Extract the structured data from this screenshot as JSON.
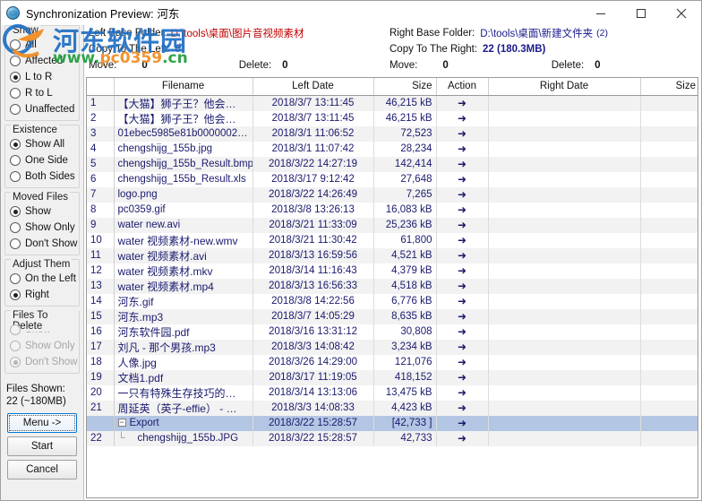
{
  "window": {
    "title": "Synchronization Preview: 河东",
    "icon": "globe-icon",
    "minimize": "−",
    "maximize": "□",
    "close": "✕"
  },
  "watermark": {
    "cn": "河东软件园",
    "en_prefix": "www.",
    "en_mid": "pc0359",
    "en_suffix": ".cn",
    "full_en": "www.pc0359.cn"
  },
  "sidebar": {
    "groups": [
      {
        "label": "Show",
        "items": [
          {
            "label": "All",
            "checked": false,
            "disabled": false
          },
          {
            "label": "Affected",
            "checked": false,
            "disabled": false
          },
          {
            "label": "L to R",
            "checked": true,
            "disabled": false
          },
          {
            "label": "R to L",
            "checked": false,
            "disabled": false
          },
          {
            "label": "Unaffected",
            "checked": false,
            "disabled": false
          }
        ]
      },
      {
        "label": "Existence",
        "items": [
          {
            "label": "Show All",
            "checked": true,
            "disabled": false
          },
          {
            "label": "One Side",
            "checked": false,
            "disabled": false
          },
          {
            "label": "Both Sides",
            "checked": false,
            "disabled": false
          }
        ]
      },
      {
        "label": "Moved Files",
        "items": [
          {
            "label": "Show",
            "checked": true,
            "disabled": false
          },
          {
            "label": "Show Only",
            "checked": false,
            "disabled": false
          },
          {
            "label": "Don't Show",
            "checked": false,
            "disabled": false
          }
        ]
      },
      {
        "label": "Adjust Them",
        "items": [
          {
            "label": "On the Left",
            "checked": false,
            "disabled": false
          },
          {
            "label": "Right",
            "checked": true,
            "disabled": false
          }
        ]
      },
      {
        "label": "Files To Delete",
        "items": [
          {
            "label": "Show",
            "checked": false,
            "disabled": true
          },
          {
            "label": "Show Only",
            "checked": false,
            "disabled": true
          },
          {
            "label": "Don't Show",
            "checked": true,
            "disabled": true
          }
        ]
      }
    ],
    "files_shown_label": "Files Shown:",
    "files_shown_value": "22 (~180MB)",
    "buttons": {
      "menu": "Menu ->",
      "start": "Start",
      "cancel": "Cancel"
    }
  },
  "info": {
    "left": {
      "base_folder_label": "Left Base Folder:",
      "base_folder_value": "D:\\tools\\桌面\\图片音视频素材",
      "copy_label": "Copy To The Left:",
      "copy_value": "0",
      "move_label": "Move:",
      "move_value": "0",
      "delete_label": "Delete:",
      "delete_value": "0"
    },
    "right": {
      "base_folder_label": "Right Base Folder:",
      "base_folder_value": "D:\\tools\\桌面\\新建文件夹",
      "base_folder_suffix": "(2)",
      "copy_label": "Copy To The Right:",
      "copy_value": "22 (180.3MB)",
      "move_label": "Move:",
      "move_value": "0",
      "delete_label": "Delete:",
      "delete_value": "0"
    }
  },
  "table": {
    "columns": [
      "",
      "Filename",
      "Left Date",
      "Size",
      "Action",
      "Right Date",
      "Size"
    ],
    "rows": [
      {
        "idx": "1",
        "name": "【大猫】狮子王？他会…",
        "cn": true,
        "ldate": "2018/3/7 13:11:45",
        "lsize": "46,215 kB",
        "action": "➜",
        "rdate": "",
        "rsize": "",
        "type": "file"
      },
      {
        "idx": "2",
        "name": "【大猫】狮子王？他会…",
        "cn": true,
        "ldate": "2018/3/7 13:11:45",
        "lsize": "46,215 kB",
        "action": "➜",
        "rdate": "",
        "rsize": "",
        "type": "file"
      },
      {
        "idx": "3",
        "name": "01ebec5985e81b0000002…",
        "cn": false,
        "ldate": "2018/3/1 11:06:52",
        "lsize": "72,523",
        "action": "➜",
        "rdate": "",
        "rsize": "",
        "type": "file"
      },
      {
        "idx": "4",
        "name": "chengshijg_155b.jpg",
        "cn": false,
        "ldate": "2018/3/1 11:07:42",
        "lsize": "28,234",
        "action": "➜",
        "rdate": "",
        "rsize": "",
        "type": "file"
      },
      {
        "idx": "5",
        "name": "chengshijg_155b_Result.bmp",
        "cn": false,
        "ldate": "2018/3/22 14:27:19",
        "lsize": "142,414",
        "action": "➜",
        "rdate": "",
        "rsize": "",
        "type": "file"
      },
      {
        "idx": "6",
        "name": "chengshijg_155b_Result.xls",
        "cn": false,
        "ldate": "2018/3/17 9:12:42",
        "lsize": "27,648",
        "action": "➜",
        "rdate": "",
        "rsize": "",
        "type": "file"
      },
      {
        "idx": "7",
        "name": "logo.png",
        "cn": false,
        "ldate": "2018/3/22 14:26:49",
        "lsize": "7,265",
        "action": "➜",
        "rdate": "",
        "rsize": "",
        "type": "file"
      },
      {
        "idx": "8",
        "name": "pc0359.gif",
        "cn": false,
        "ldate": "2018/3/8 13:26:13",
        "lsize": "16,083 kB",
        "action": "➜",
        "rdate": "",
        "rsize": "",
        "type": "file"
      },
      {
        "idx": "9",
        "name": "water  new.avi",
        "cn": false,
        "ldate": "2018/3/21 11:33:09",
        "lsize": "25,236 kB",
        "action": "➜",
        "rdate": "",
        "rsize": "",
        "type": "file"
      },
      {
        "idx": "10",
        "name": "water 视频素材-new.wmv",
        "cn": true,
        "ldate": "2018/3/21 11:30:42",
        "lsize": "61,800",
        "action": "➜",
        "rdate": "",
        "rsize": "",
        "type": "file"
      },
      {
        "idx": "11",
        "name": "water 视频素材.avi",
        "cn": true,
        "ldate": "2018/3/13 16:59:56",
        "lsize": "4,521 kB",
        "action": "➜",
        "rdate": "",
        "rsize": "",
        "type": "file"
      },
      {
        "idx": "12",
        "name": "water 视频素材.mkv",
        "cn": true,
        "ldate": "2018/3/14 11:16:43",
        "lsize": "4,379 kB",
        "action": "➜",
        "rdate": "",
        "rsize": "",
        "type": "file"
      },
      {
        "idx": "13",
        "name": "water 视频素材.mp4",
        "cn": true,
        "ldate": "2018/3/13 16:56:33",
        "lsize": "4,518 kB",
        "action": "➜",
        "rdate": "",
        "rsize": "",
        "type": "file"
      },
      {
        "idx": "14",
        "name": "河东.gif",
        "cn": true,
        "ldate": "2018/3/8 14:22:56",
        "lsize": "6,776 kB",
        "action": "➜",
        "rdate": "",
        "rsize": "",
        "type": "file"
      },
      {
        "idx": "15",
        "name": "河东.mp3",
        "cn": true,
        "ldate": "2018/3/7 14:05:29",
        "lsize": "8,635 kB",
        "action": "➜",
        "rdate": "",
        "rsize": "",
        "type": "file"
      },
      {
        "idx": "16",
        "name": "河东软件园.pdf",
        "cn": true,
        "ldate": "2018/3/16 13:31:12",
        "lsize": "30,808",
        "action": "➜",
        "rdate": "",
        "rsize": "",
        "type": "file"
      },
      {
        "idx": "17",
        "name": "刘凡 - 那个男孩.mp3",
        "cn": true,
        "ldate": "2018/3/3 14:08:42",
        "lsize": "3,234 kB",
        "action": "➜",
        "rdate": "",
        "rsize": "",
        "type": "file"
      },
      {
        "idx": "18",
        "name": "人像.jpg",
        "cn": true,
        "ldate": "2018/3/26 14:29:00",
        "lsize": "121,076",
        "action": "➜",
        "rdate": "",
        "rsize": "",
        "type": "file"
      },
      {
        "idx": "19",
        "name": "文档1.pdf",
        "cn": true,
        "ldate": "2018/3/17 11:19:05",
        "lsize": "418,152",
        "action": "➜",
        "rdate": "",
        "rsize": "",
        "type": "file"
      },
      {
        "idx": "20",
        "name": "一只有特殊生存技巧的…",
        "cn": true,
        "ldate": "2018/3/14 13:13:06",
        "lsize": "13,475 kB",
        "action": "➜",
        "rdate": "",
        "rsize": "",
        "type": "file"
      },
      {
        "idx": "21",
        "name": "周延英（英子-effie） - …",
        "cn": true,
        "ldate": "2018/3/3 14:08:33",
        "lsize": "4,423 kB",
        "action": "➜",
        "rdate": "",
        "rsize": "",
        "type": "file"
      },
      {
        "idx": "",
        "name": "Export",
        "cn": false,
        "ldate": "2018/3/22 15:28:57",
        "lsize": "[42,733 ]",
        "action": "➜",
        "rdate": "",
        "rsize": "",
        "type": "folder",
        "selected": true,
        "expander": "−"
      },
      {
        "idx": "22",
        "name": "chengshijg_155b.JPG",
        "cn": false,
        "ldate": "2018/3/22 15:28:57",
        "lsize": "42,733",
        "action": "➜",
        "rdate": "",
        "rsize": "",
        "type": "child"
      }
    ]
  }
}
